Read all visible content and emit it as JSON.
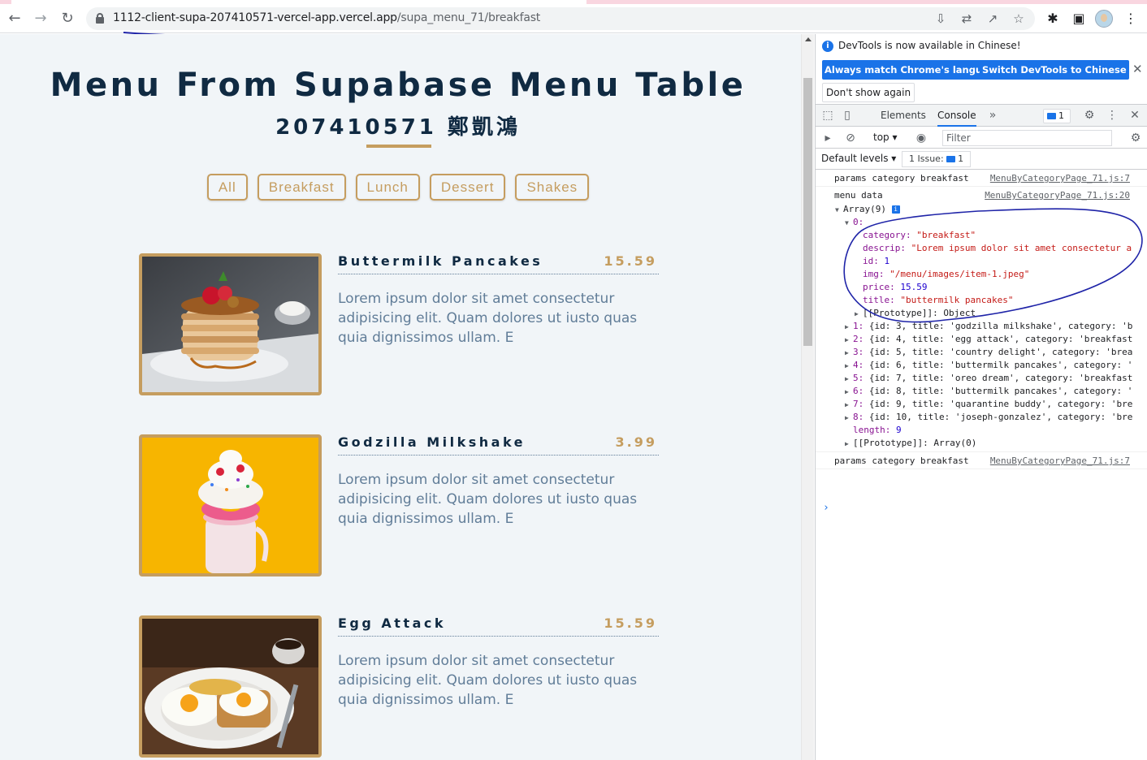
{
  "browser": {
    "url_host": "1112-client-supa-207410571-vercel-app.vercel.app",
    "url_path": "/supa_menu_71/breakfast"
  },
  "page": {
    "title": "Menu From Supabase Menu Table",
    "subtitle": "207410571 鄭凱鴻",
    "filters": [
      "All",
      "Breakfast",
      "Lunch",
      "Dessert",
      "Shakes"
    ],
    "items": [
      {
        "title": "Buttermilk Pancakes",
        "price": "15.59",
        "desc": "Lorem ipsum dolor sit amet consectetur adipisicing elit. Quam dolores ut iusto quas quia dignissimos ullam. E"
      },
      {
        "title": "Godzilla Milkshake",
        "price": "3.99",
        "desc": "Lorem ipsum dolor sit amet consectetur adipisicing elit. Quam dolores ut iusto quas quia dignissimos ullam. E"
      },
      {
        "title": "Egg Attack",
        "price": "15.59",
        "desc": "Lorem ipsum dolor sit amet consectetur adipisicing elit. Quam dolores ut iusto quas quia dignissimos ullam. E"
      }
    ],
    "colors": {
      "accent": "#c59d5f",
      "heading": "#102a42",
      "text": "#617d98",
      "background": "#f1f5f8"
    }
  },
  "devtools": {
    "info_text": "DevTools is now available in Chinese!",
    "btn_match": "Always match Chrome's language",
    "btn_switch": "Switch DevTools to Chinese",
    "btn_dont_show": "Don't show again",
    "tab_elements": "Elements",
    "tab_console": "Console",
    "messages_count": "1",
    "context": "top",
    "filter_placeholder": "Filter",
    "levels": "Default levels",
    "issues_label": "1 Issue:",
    "issues_count": "1",
    "console": {
      "log1": {
        "msg": "params category breakfast",
        "src": "MenuByCategoryPage_71.js:7"
      },
      "log2": {
        "msg": "menu data",
        "src": "MenuByCategoryPage_71.js:20"
      },
      "array_label": "Array(9)",
      "item0": {
        "index": "0:",
        "category_key": "category:",
        "category_val": "\"breakfast\"",
        "descrip_key": "descrip:",
        "descrip_val": "\"Lorem ipsum dolor sit amet consectetur a",
        "id_key": "id:",
        "id_val": "1",
        "img_key": "img:",
        "img_val": "\"/menu/images/item-1.jpeg\"",
        "price_key": "price:",
        "price_val": "15.59",
        "title_key": "title:",
        "title_val": "\"buttermilk pancakes\"",
        "proto": "[[Prototype]]: Object"
      },
      "rows": [
        {
          "idx": "1:",
          "text": "{id: 3, title: 'godzilla milkshake', category: 'b"
        },
        {
          "idx": "2:",
          "text": "{id: 4, title: 'egg attack', category: 'breakfast"
        },
        {
          "idx": "3:",
          "text": "{id: 5, title: 'country delight', category: 'brea"
        },
        {
          "idx": "4:",
          "text": "{id: 6, title: 'buttermilk pancakes', category: '"
        },
        {
          "idx": "5:",
          "text": "{id: 7, title: 'oreo dream', category: 'breakfast"
        },
        {
          "idx": "6:",
          "text": "{id: 8, title: 'buttermilk pancakes', category: '"
        },
        {
          "idx": "7:",
          "text": "{id: 9, title: 'quarantine buddy', category: 'bre"
        },
        {
          "idx": "8:",
          "text": "{id: 10, title: 'joseph-gonzalez', category: 'bre"
        }
      ],
      "length_key": "length:",
      "length_val": "9",
      "array_proto": "[[Prototype]]: Array(0)",
      "log3": {
        "msg": "params category breakfast",
        "src": "MenuByCategoryPage_71.js:7"
      }
    }
  }
}
